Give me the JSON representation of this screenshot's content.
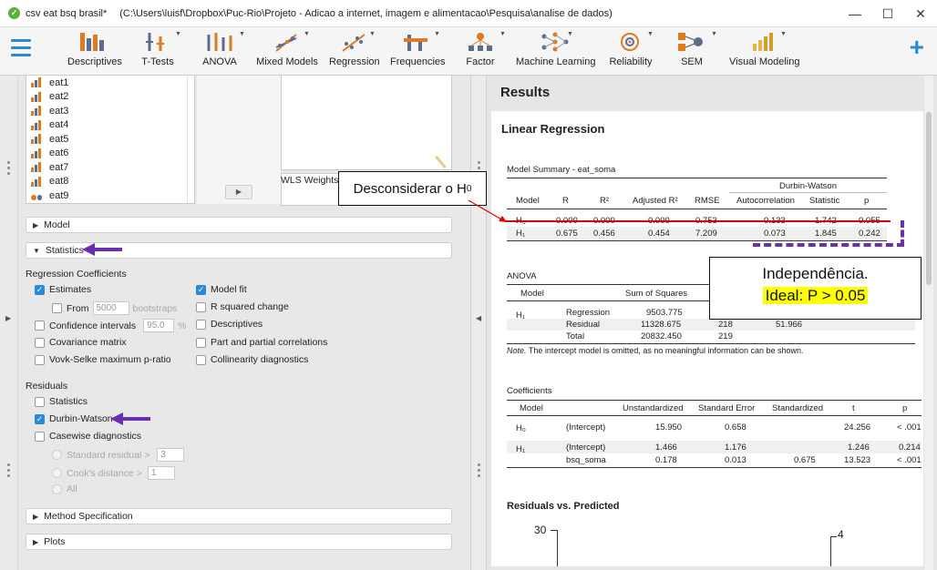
{
  "window": {
    "app_title": "csv eat bsq brasil*",
    "path": "(C:\\Users\\luisf\\Dropbox\\Puc-Rio\\Projeto - Adicao a internet, imagem e alimentacao\\Pesquisa\\analise de dados)",
    "controls": [
      "—",
      "☐",
      "✕"
    ]
  },
  "ribbon": {
    "items": [
      "Descriptives",
      "T-Tests",
      "ANOVA",
      "Mixed Models",
      "Regression",
      "Frequencies",
      "Factor",
      "Machine Learning",
      "Reliability",
      "SEM",
      "Visual Modeling"
    ],
    "add": "+"
  },
  "variables": [
    "eat1",
    "eat2",
    "eat3",
    "eat4",
    "eat5",
    "eat6",
    "eat7",
    "eat8",
    "eat9"
  ],
  "wls_label": "WLS Weights (",
  "sections": {
    "model": "Model",
    "statistics": "Statistics",
    "method_specification": "Method Specification",
    "plots": "Plots"
  },
  "regression_coefficients": {
    "title": "Regression Coefficients",
    "estimates": "Estimates",
    "from": "From",
    "from_value": "5000",
    "bootstraps": "bootstraps",
    "confidence_intervals": "Confidence intervals",
    "ci_value": "95.0",
    "percent": "%",
    "covariance_matrix": "Covariance matrix",
    "vovk_sellke": "Vovk-Selke maximum p-ratio",
    "model_fit": "Model fit",
    "r_squared_change": "R squared change",
    "descriptives": "Descriptives",
    "part_partial": "Part and partial correlations",
    "collinearity": "Collinearity diagnostics"
  },
  "residuals": {
    "title": "Residuals",
    "statistics": "Statistics",
    "durbin_watson": "Durbin-Watson",
    "casewise": "Casewise diagnostics",
    "standard_residual": "Standard residual >",
    "standard_residual_value": "3",
    "cooks_distance": "Cook's distance >",
    "cooks_value": "1",
    "all": "All"
  },
  "results": {
    "title": "Results",
    "heading": "Linear Regression",
    "model_summary": {
      "title": "Model Summary - eat_soma",
      "group_header": "Durbin-Watson",
      "headers": [
        "Model",
        "R",
        "R²",
        "Adjusted R²",
        "RMSE",
        "Autocorrelation",
        "Statistic",
        "p"
      ],
      "rows": [
        [
          "H₀",
          "0.000",
          "0.000",
          "0.000",
          "0.753",
          "0.133",
          "1.742",
          "0.055"
        ],
        [
          "H₁",
          "0.675",
          "0.456",
          "0.454",
          "7.209",
          "0.073",
          "1.845",
          "0.242"
        ]
      ]
    },
    "anova": {
      "title": "ANOVA",
      "headers": [
        "Model",
        "Sum of Squares"
      ],
      "model": "H₁",
      "rows": [
        [
          "Regression",
          "9503.775",
          "",
          ""
        ],
        [
          "Residual",
          "11328.675",
          "218",
          "51.966"
        ],
        [
          "Total",
          "20832.450",
          "219",
          ""
        ]
      ],
      "note_label": "Note.",
      "note": "The intercept model is omitted, as no meaningful information can be shown."
    },
    "coefficients": {
      "title": "Coefficients",
      "headers": [
        "Model",
        "Unstandardized",
        "Standard Error",
        "Standardized",
        "t",
        "p"
      ],
      "rows": [
        [
          "H₀",
          "(Intercept)",
          "15.950",
          "0.658",
          "",
          "24.256",
          "< .001"
        ],
        [
          "H₁",
          "(Intercept)",
          "1.466",
          "1.176",
          "",
          "1.246",
          "0.214"
        ],
        [
          "",
          "bsq_soma",
          "0.178",
          "0.013",
          "0.675",
          "13.523",
          "< .001"
        ]
      ]
    },
    "residuals_plot": {
      "title": "Residuals vs. Predicted",
      "left_tick": "30",
      "right_tick": "4"
    }
  },
  "annotations": {
    "callout1": "Desconsiderar o H",
    "callout1_sub": "0",
    "callout2_line1": "Independência.",
    "callout2_line2": "Ideal: P > 0.05",
    "red_color": "#e00000",
    "purple_color": "#6a2fb0"
  }
}
